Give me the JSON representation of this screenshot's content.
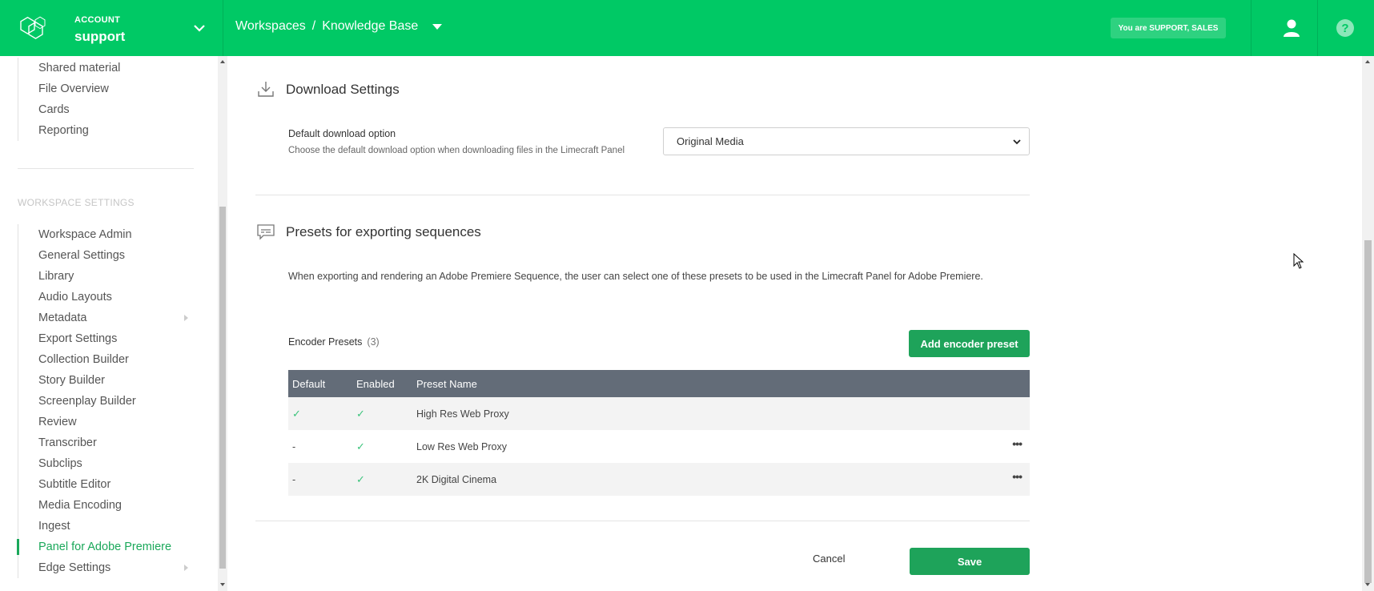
{
  "header": {
    "account_label": "ACCOUNT",
    "account_name": "support",
    "breadcrumb": {
      "root": "Workspaces",
      "separator": "/",
      "current": "Knowledge Base"
    },
    "role_badge": "You are SUPPORT, SALES",
    "icons": {
      "logo": "limecraft-logo",
      "account_toggle": "chevron-down-icon",
      "user": "user-icon",
      "help": "help-icon"
    }
  },
  "sidebar": {
    "top_items": [
      {
        "label": "Shared material"
      },
      {
        "label": "File Overview"
      },
      {
        "label": "Cards"
      },
      {
        "label": "Reporting"
      }
    ],
    "section_title": "WORKSPACE SETTINGS",
    "items": [
      {
        "label": "Workspace Admin"
      },
      {
        "label": "General Settings"
      },
      {
        "label": "Library"
      },
      {
        "label": "Audio Layouts"
      },
      {
        "label": "Metadata",
        "has_submenu": true
      },
      {
        "label": "Export Settings"
      },
      {
        "label": "Collection Builder"
      },
      {
        "label": "Story Builder"
      },
      {
        "label": "Screenplay Builder"
      },
      {
        "label": "Review"
      },
      {
        "label": "Transcriber"
      },
      {
        "label": "Subclips"
      },
      {
        "label": "Subtitle Editor"
      },
      {
        "label": "Media Encoding"
      },
      {
        "label": "Ingest"
      },
      {
        "label": "Panel for Adobe Premiere",
        "active": true
      },
      {
        "label": "Edge Settings",
        "has_submenu": true
      }
    ]
  },
  "download": {
    "title": "Download Settings",
    "icon": "download-icon",
    "field_label": "Default download option",
    "field_help": "Choose the default download option when downloading files in the Limecraft Panel",
    "selected_option": "Original Media"
  },
  "presets": {
    "title": "Presets for exporting sequences",
    "icon": "presets-icon",
    "description": "When exporting and rendering an Adobe Premiere Sequence, the user can select one of these presets to be used in the Limecraft Panel for Adobe Premiere.",
    "encoder_label": "Encoder Presets",
    "encoder_count": "(3)",
    "add_button": "Add encoder preset",
    "columns": [
      "Default",
      "Enabled",
      "Preset Name"
    ],
    "rows": [
      {
        "default": "✓",
        "enabled": "✓",
        "name": "High Res Web Proxy",
        "has_menu": false
      },
      {
        "default": "-",
        "enabled": "✓",
        "name": "Low Res Web Proxy",
        "has_menu": true,
        "menu": "•••"
      },
      {
        "default": "-",
        "enabled": "✓",
        "name": "2K Digital Cinema",
        "has_menu": true,
        "menu": "•••"
      }
    ]
  },
  "footer": {
    "cancel": "Cancel",
    "save": "Save"
  },
  "colors": {
    "brand": "#00c965",
    "button": "#1ea35a",
    "table_header": "#636c78",
    "active_nav": "#1aa85a"
  }
}
